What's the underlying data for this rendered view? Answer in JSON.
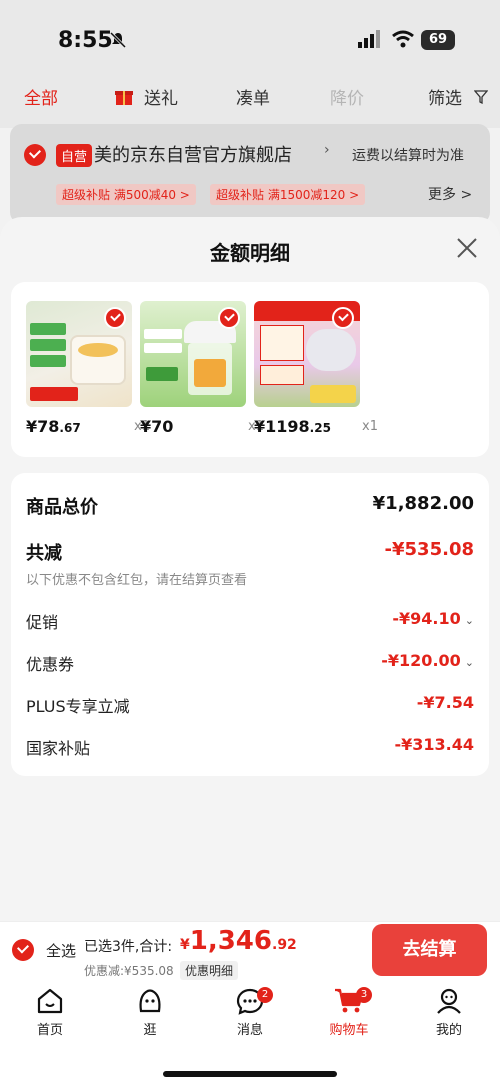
{
  "status_bar": {
    "time": "8:55",
    "battery": "69"
  },
  "filter_tabs": {
    "all": "全部",
    "gift": "送礼",
    "bundle": "凑单",
    "price_drop": "降价",
    "filter": "筛选"
  },
  "shop": {
    "badge": "自营",
    "name": "美的京东自营官方旗舰店",
    "shipping": "运费以结算时为准",
    "coupons": [
      "超级补贴 满500减40 >",
      "超级补贴 满1500减120 >"
    ],
    "more": "更多 >"
  },
  "sheet": {
    "title": "金额明细",
    "products": [
      {
        "price_int": "¥78",
        "price_dec": ".67",
        "qty": "x1"
      },
      {
        "price_int": "¥70",
        "price_dec": "",
        "qty": "x1"
      },
      {
        "price_int": "¥1198",
        "price_dec": ".25",
        "qty": "x1"
      }
    ],
    "summary": {
      "total_label": "商品总价",
      "total_value": "¥1,882.00",
      "reduce_label": "共减",
      "reduce_value": "-¥535.08",
      "note": "以下优惠不包含红包，请在结算页查看",
      "promo_label": "促销",
      "promo_value": "-¥94.10",
      "coupon_label": "优惠券",
      "coupon_value": "-¥120.00",
      "plus_label": "PLUS专享立减",
      "plus_value": "-¥7.54",
      "subsidy_label": "国家补贴",
      "subsidy_value": "-¥313.44"
    }
  },
  "bottom_bar": {
    "select_all": "全选",
    "selected_text": "已选3件,合计:",
    "total_cur": "¥",
    "total_int": "1,346",
    "total_dec": ".92",
    "discount_text": "优惠减:¥535.08",
    "detail_button": "优惠明细",
    "checkout_button": "去结算"
  },
  "nav": {
    "home": "首页",
    "browse": "逛",
    "messages": "消息",
    "messages_badge": "2",
    "cart": "购物车",
    "cart_badge": "3",
    "me": "我的"
  },
  "colors": {
    "accent": "#e2231a",
    "checkout": "#e9413b"
  }
}
